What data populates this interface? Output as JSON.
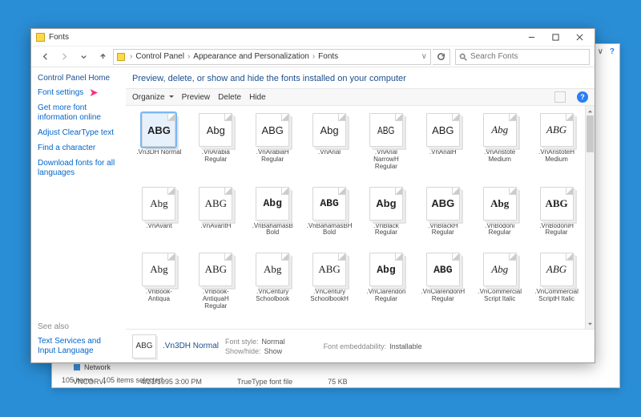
{
  "window": {
    "title": "Fonts",
    "breadcrumb": [
      "Control Panel",
      "Appearance and Personalization",
      "Fonts"
    ],
    "search_placeholder": "Search Fonts"
  },
  "sidebar": {
    "home": "Control Panel Home",
    "links": [
      "Font settings",
      "Get more font information online",
      "Adjust ClearType text",
      "Find a character",
      "Download fonts for all languages"
    ],
    "see_also_header": "See also",
    "see_also": [
      "Text Services and Input Language"
    ]
  },
  "main": {
    "heading": "Preview, delete, or show and hide the fonts installed on your computer",
    "toolbar": {
      "organize": "Organize",
      "preview": "Preview",
      "delete": "Delete",
      "hide": "Hide"
    }
  },
  "fonts": [
    {
      "label": ".Vn3DH Normal",
      "sample": "ABG",
      "style": "st-bold",
      "selected": true
    },
    {
      "label": ".VnArabia Regular",
      "sample": "Abg",
      "style": "st-head"
    },
    {
      "label": ".VnArabiaH Regular",
      "sample": "ABG",
      "style": "st-head"
    },
    {
      "label": ".VnArial",
      "sample": "Abg",
      "style": ""
    },
    {
      "label": ".VnArial NarrowH Regular",
      "sample": "ABG",
      "style": "st-narrow"
    },
    {
      "label": ".VnArialH",
      "sample": "ABG",
      "style": ""
    },
    {
      "label": ".VnAristote Medium",
      "sample": "Abg",
      "style": "st-scriptb"
    },
    {
      "label": ".VnAristoteH Medium",
      "sample": "ABG",
      "style": "st-scriptb"
    },
    {
      "label": ".VnAvant",
      "sample": "Abg",
      "style": "st-serif"
    },
    {
      "label": ".VnAvantH",
      "sample": "ABG",
      "style": "st-serif"
    },
    {
      "label": ".VnBahamasB Bold",
      "sample": "Abg",
      "style": "st-slab"
    },
    {
      "label": ".VnBahamasBH Bold",
      "sample": "ABG",
      "style": "st-slab"
    },
    {
      "label": ".VnBlack Regular",
      "sample": "Abg",
      "style": "st-bold"
    },
    {
      "label": ".VnBlackH Regular",
      "sample": "ABG",
      "style": "st-bold"
    },
    {
      "label": ".VnBodoni Regular",
      "sample": "Abg",
      "style": "st-disp"
    },
    {
      "label": ".VnBodoniH Regular",
      "sample": "ABG",
      "style": "st-disp"
    },
    {
      "label": ".VnBook-Antiqua",
      "sample": "Abg",
      "style": "st-old"
    },
    {
      "label": ".VnBook-AntiquaH Regular",
      "sample": "ABG",
      "style": "st-old"
    },
    {
      "label": ".VnCentury Schoolbook",
      "sample": "Abg",
      "style": "st-old"
    },
    {
      "label": ".VnCentury SchoolbookH",
      "sample": "ABG",
      "style": "st-old"
    },
    {
      "label": ".VnClarendon Regular",
      "sample": "Abg",
      "style": "st-slab"
    },
    {
      "label": ".VnClarendonH Regular",
      "sample": "ABG",
      "style": "st-slab"
    },
    {
      "label": ".VnCommercial Script Italic",
      "sample": "Abg",
      "style": "st-script st-italic"
    },
    {
      "label": ".VnCommercial ScriptH Italic",
      "sample": "ABG",
      "style": "st-script st-italic"
    }
  ],
  "details": {
    "name": ".Vn3DH Normal",
    "font_style_label": "Font style:",
    "font_style": "Normal",
    "show_hide_label": "Show/hide:",
    "show_hide": "Show",
    "embed_label": "Font embeddability:",
    "embed": "Installable"
  },
  "bg_window": {
    "row_name": "VNCORVI",
    "row_date": "4/21/1995 3:00 PM",
    "row_type": "TrueType font file",
    "row_size": "75 KB",
    "network": "Network",
    "status_items": "105 items",
    "status_sel": "105 items selected"
  }
}
